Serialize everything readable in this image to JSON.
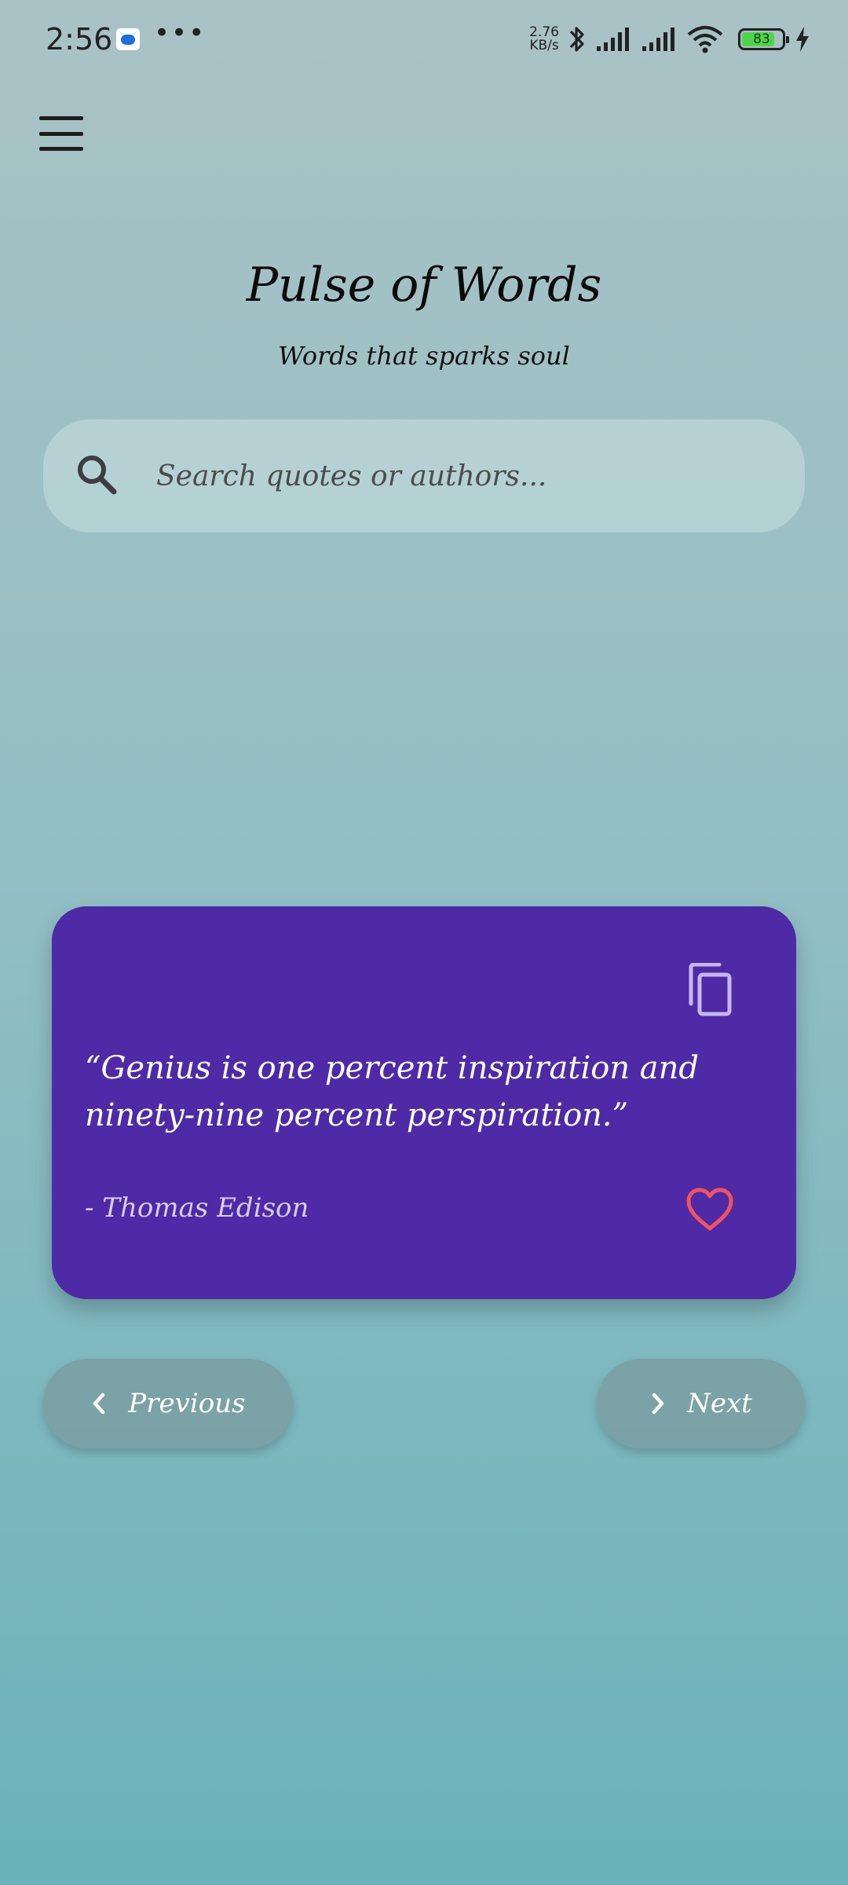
{
  "status_bar": {
    "time": "2:56",
    "more": "•••",
    "net_speed_value": "2.76",
    "net_speed_unit": "KB/s",
    "battery_level": "83",
    "battery_fraction": 0.83,
    "battery_color": "#4cd44c"
  },
  "header": {
    "title": "Pulse of Words",
    "subtitle": "Words that sparks soul"
  },
  "search": {
    "placeholder": "Search quotes or authors..."
  },
  "quote_card": {
    "text": "“Genius is one percent inspiration and ninety-nine percent perspiration.”",
    "author": "- Thomas Edison",
    "background_color": "#4f2aa6",
    "heart_color": "#f2525e"
  },
  "navigation": {
    "previous_label": "Previous",
    "next_label": "Next"
  },
  "icons": {
    "menu": "menu-icon",
    "search": "search-icon",
    "copy": "copy-icon",
    "favorite": "heart-outline-icon",
    "previous": "chevron-left-icon",
    "next": "chevron-right-icon"
  }
}
